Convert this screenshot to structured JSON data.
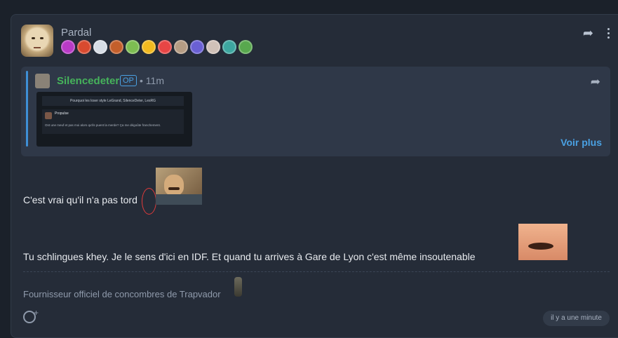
{
  "post": {
    "username": "Pardal",
    "badges": [
      {
        "name": "badge-1",
        "color": "#b93ac7"
      },
      {
        "name": "badge-2",
        "color": "#d94a2f"
      },
      {
        "name": "badge-3",
        "color": "#d7dde5"
      },
      {
        "name": "badge-4",
        "color": "#c45f2b"
      },
      {
        "name": "badge-5",
        "color": "#7dbd52"
      },
      {
        "name": "badge-6",
        "color": "#f2b91f"
      },
      {
        "name": "badge-7",
        "color": "#e84545"
      },
      {
        "name": "badge-8",
        "color": "#b69d84"
      },
      {
        "name": "badge-9",
        "color": "#6a60d4"
      },
      {
        "name": "badge-10",
        "color": "#d0c1b8"
      },
      {
        "name": "badge-11",
        "color": "#3da7a0"
      },
      {
        "name": "badge-12",
        "color": "#58a84e"
      }
    ]
  },
  "quote": {
    "username": "Silencedeter",
    "op_label": "OP",
    "time": "• 11m",
    "voir_plus": "Voir plus",
    "screenshot_title": "Pourquoi les loser style LeGrand, SilenceDeter, LesRG",
    "screenshot_name": "Propulse",
    "screenshot_text": "Ont une meuf et pas moi alors qu'ils puent la merde? Ça me dégoûte franchement."
  },
  "content": {
    "line1": "C'est vrai qu'il n'a pas tord",
    "line2": "Tu schlingues khey. Je le sens d'ici en IDF. Et quand tu arrives à Gare de Lyon c'est même insoutenable"
  },
  "signature": "Fournisseur officiel de concombres de Trapvador",
  "timestamp": "il y a une minute"
}
